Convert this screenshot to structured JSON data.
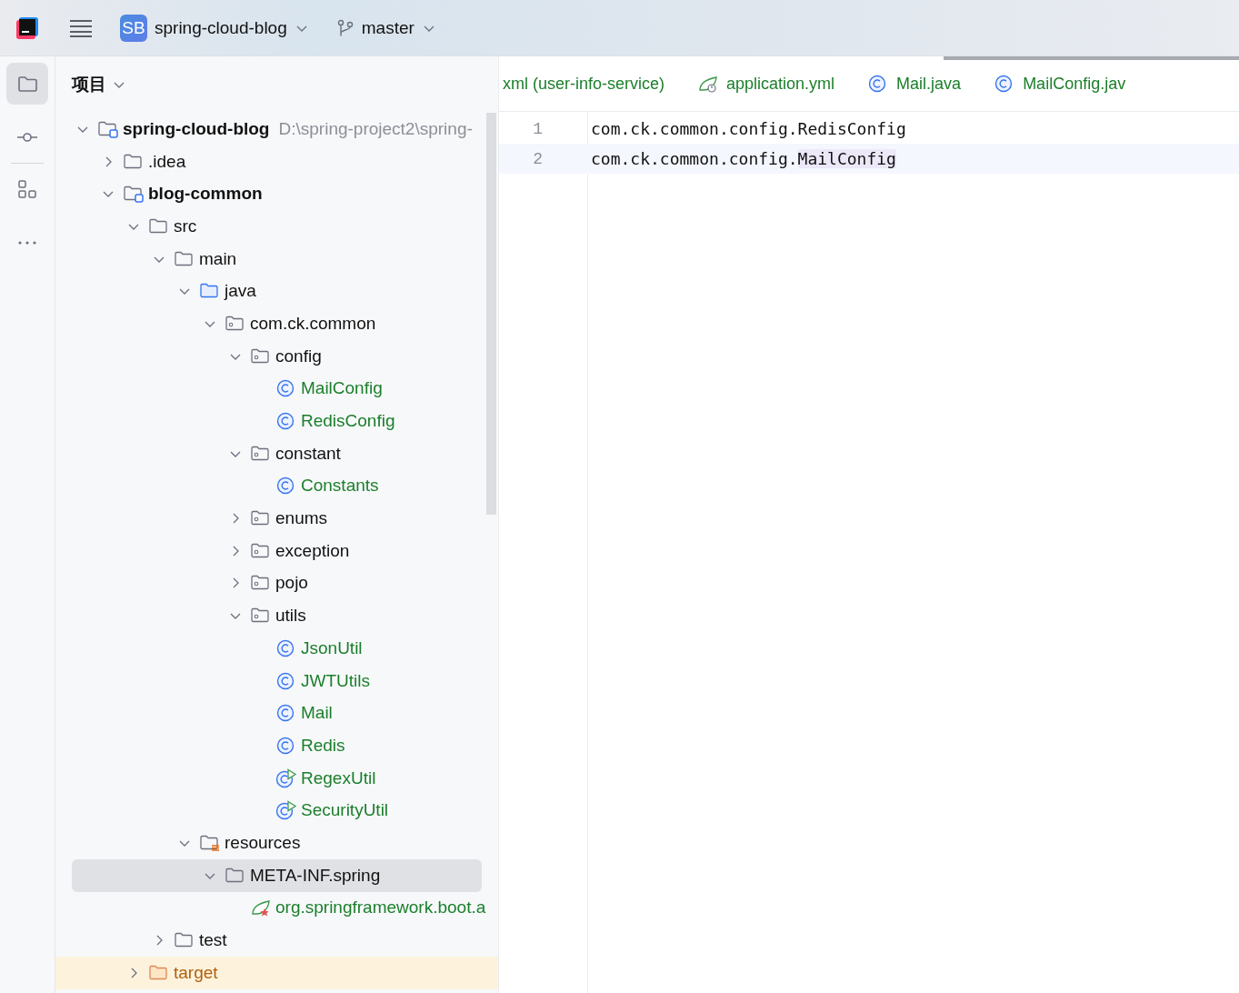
{
  "title_bar": {
    "project_badge": "SB",
    "project": "spring-cloud-blog",
    "branch": "master"
  },
  "tool_strip": [
    {
      "kind": "project",
      "selected": true
    },
    {
      "kind": "commit",
      "selected": false
    },
    {
      "kind": "structure",
      "selected": false
    },
    {
      "kind": "more",
      "selected": false
    }
  ],
  "project_panel": {
    "title": "项目",
    "tree": [
      {
        "label": "spring-cloud-blog",
        "detail": "D:\\spring-project2\\spring-",
        "kind": "module",
        "expanded": true,
        "selected": false,
        "children": [
          {
            "label": ".idea",
            "kind": "folder",
            "expanded": false,
            "selected": false
          },
          {
            "label": "blog-common",
            "kind": "module",
            "expanded": true,
            "selected": false,
            "children": [
              {
                "label": "src",
                "kind": "folder",
                "expanded": true,
                "selected": false,
                "children": [
                  {
                    "label": "main",
                    "kind": "folder",
                    "expanded": true,
                    "selected": false,
                    "children": [
                      {
                        "label": "java",
                        "kind": "source",
                        "expanded": true,
                        "selected": false,
                        "children": [
                          {
                            "label": "com.ck.common",
                            "kind": "package",
                            "expanded": true,
                            "selected": false,
                            "children": [
                              {
                                "label": "config",
                                "kind": "package",
                                "expanded": true,
                                "selected": false,
                                "children": [
                                  {
                                    "label": "MailConfig",
                                    "kind": "class",
                                    "selected": false
                                  },
                                  {
                                    "label": "RedisConfig",
                                    "kind": "class",
                                    "selected": false
                                  }
                                ]
                              },
                              {
                                "label": "constant",
                                "kind": "package",
                                "expanded": true,
                                "selected": false,
                                "children": [
                                  {
                                    "label": "Constants",
                                    "kind": "class",
                                    "selected": false
                                  }
                                ]
                              },
                              {
                                "label": "enums",
                                "kind": "package",
                                "expanded": false,
                                "selected": false
                              },
                              {
                                "label": "exception",
                                "kind": "package",
                                "expanded": false,
                                "selected": false
                              },
                              {
                                "label": "pojo",
                                "kind": "package",
                                "expanded": false,
                                "selected": false
                              },
                              {
                                "label": "utils",
                                "kind": "package",
                                "expanded": true,
                                "selected": false,
                                "children": [
                                  {
                                    "label": "JsonUtil",
                                    "kind": "class",
                                    "selected": false
                                  },
                                  {
                                    "label": "JWTUtils",
                                    "kind": "class",
                                    "selected": false
                                  },
                                  {
                                    "label": "Mail",
                                    "kind": "class",
                                    "selected": false
                                  },
                                  {
                                    "label": "Redis",
                                    "kind": "class",
                                    "selected": false
                                  },
                                  {
                                    "label": "RegexUtil",
                                    "kind": "runnable",
                                    "selected": false
                                  },
                                  {
                                    "label": "SecurityUtil",
                                    "kind": "runnable",
                                    "selected": false
                                  }
                                ]
                              }
                            ]
                          }
                        ]
                      },
                      {
                        "label": "resources",
                        "kind": "resources",
                        "expanded": true,
                        "selected": false,
                        "children": [
                          {
                            "label": "META-INF.spring",
                            "kind": "folder",
                            "expanded": true,
                            "selected": true,
                            "children": [
                              {
                                "label": "org.springframework.boot.a",
                                "kind": "spring",
                                "selected": false
                              }
                            ]
                          }
                        ]
                      }
                    ]
                  },
                  {
                    "label": "test",
                    "kind": "folder",
                    "expanded": false,
                    "selected": false
                  }
                ]
              },
              {
                "label": "target",
                "kind": "excluded",
                "expanded": false,
                "selected": false
              }
            ]
          }
        ]
      }
    ]
  },
  "editor": {
    "tabs": [
      {
        "label": "xml (user-info-service)",
        "kind": "none"
      },
      {
        "label": "application.yml",
        "kind": "yaml"
      },
      {
        "label": "Mail.java",
        "kind": "class"
      },
      {
        "label": "MailConfig.jav",
        "kind": "class"
      }
    ],
    "lines": [
      {
        "number": "1",
        "current": false,
        "segments": [
          {
            "text": "com.ck.common.config.RedisConfig",
            "marked": false
          }
        ]
      },
      {
        "number": "2",
        "current": true,
        "segments": [
          {
            "text": "com.ck.common.config.",
            "marked": false
          },
          {
            "text": "MailConfig",
            "marked": true
          }
        ]
      }
    ]
  }
}
